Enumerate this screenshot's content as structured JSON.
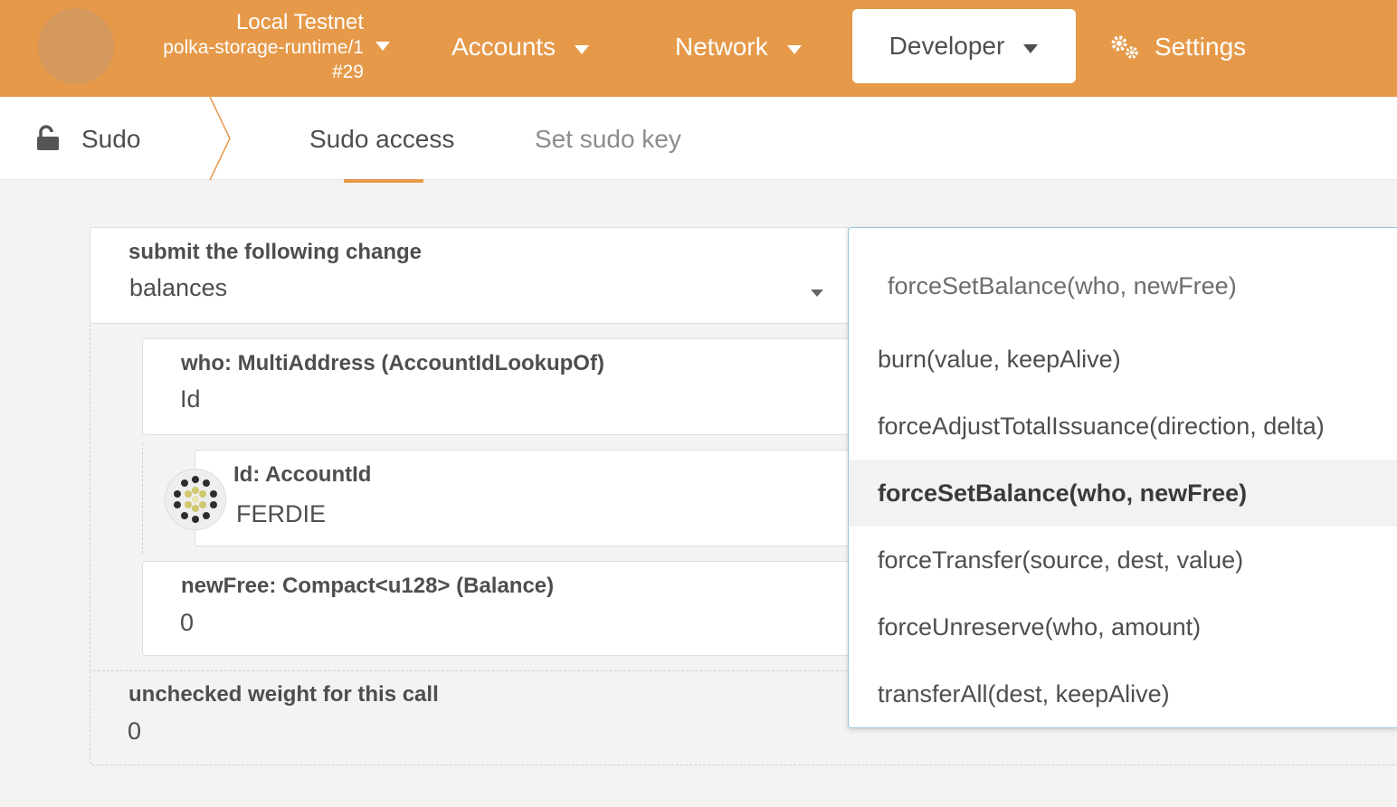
{
  "colors": {
    "accent": "#e59949",
    "background": "#f4f3f1"
  },
  "chain": {
    "name": "Local Testnet",
    "runtime": "polka-storage-runtime/1",
    "block": "#29"
  },
  "nav": {
    "accounts": "Accounts",
    "network": "Network",
    "developer": "Developer",
    "settings": "Settings"
  },
  "subnav": {
    "title": "Sudo",
    "tabs": [
      "Sudo access",
      "Set sudo key"
    ]
  },
  "form": {
    "module_label": "submit the following change",
    "module_value": "balances",
    "who_label": "who: MultiAddress (AccountIdLookupOf)",
    "who_value": "Id",
    "id_label": "Id: AccountId",
    "id_value": "FERDIE",
    "newfree_label": "newFree: Compact<u128> (Balance)",
    "newfree_value": "0",
    "weight_label": "unchecked weight for this call",
    "weight_value": "0"
  },
  "dropdown": {
    "selected_text": "forceSetBalance(who, newFree)",
    "items": [
      "burn(value, keepAlive)",
      "forceAdjustTotalIssuance(direction, delta)",
      "forceSetBalance(who, newFree)",
      "forceTransfer(source, dest, value)",
      "forceUnreserve(who, amount)",
      "transferAll(dest, keepAlive)"
    ],
    "active_index": 2
  }
}
